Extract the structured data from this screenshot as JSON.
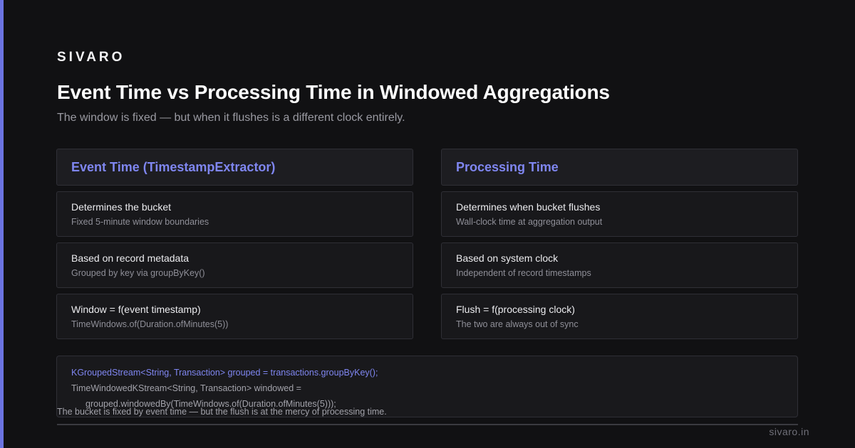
{
  "brand": "SIVARO",
  "title": "Event Time vs Processing Time in Windowed Aggregations",
  "subtitle": "The window is fixed — but when it flushes is a different clock entirely.",
  "left": {
    "header": "Event Time (TimestampExtractor)",
    "cards": [
      {
        "title": "Determines the bucket",
        "sub": "Fixed 5-minute window boundaries"
      },
      {
        "title": "Based on record metadata",
        "sub": "Grouped by key via groupByKey()"
      },
      {
        "title": "Window = f(event timestamp)",
        "sub": "TimeWindows.of(Duration.ofMinutes(5))"
      }
    ]
  },
  "right": {
    "header": "Processing Time",
    "cards": [
      {
        "title": "Determines when bucket flushes",
        "sub": "Wall-clock time at aggregation output"
      },
      {
        "title": "Based on system clock",
        "sub": "Independent of record timestamps"
      },
      {
        "title": "Flush = f(processing clock)",
        "sub": "The two are always out of sync"
      }
    ]
  },
  "code": {
    "line1": "KGroupedStream<String, Transaction> grouped = transactions.groupByKey();",
    "line2": "TimeWindowedKStream<String, Transaction> windowed =",
    "line3": "grouped.windowedBy(TimeWindows.of(Duration.ofMinutes(5)));"
  },
  "footer": {
    "caption": "The bucket is fixed by event time — but the flush is at the mercy of processing time.",
    "domain": "sivaro.in"
  },
  "colors": {
    "accent": "#6b73e0",
    "header_text": "#7f86f0",
    "background": "#111113"
  }
}
